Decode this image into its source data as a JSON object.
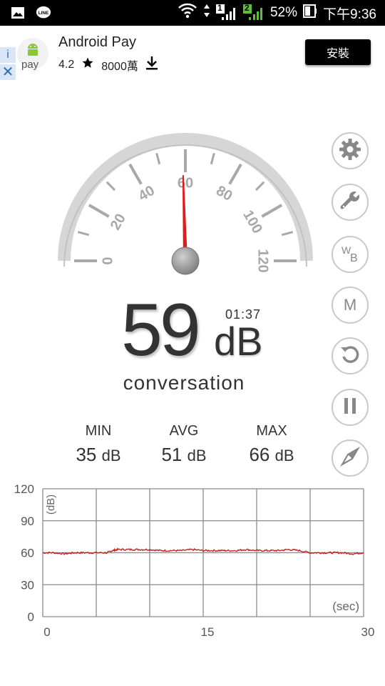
{
  "status_bar": {
    "battery": "52%",
    "time": "下午9:36",
    "sim1": "1",
    "sim2": "2"
  },
  "ad": {
    "app_name": "Android Pay",
    "logo_text": "pay",
    "rating": "4.2",
    "downloads": "8000萬",
    "install_label": "安裝"
  },
  "gauge": {
    "ticks": [
      "0",
      "20",
      "40",
      "60",
      "80",
      "100",
      "120"
    ],
    "min": 0,
    "max": 120,
    "needle_value": 59
  },
  "reading": {
    "value": "59",
    "unit": "dB",
    "timer": "01:37",
    "description": "conversation"
  },
  "stats": {
    "min_label": "MIN",
    "min_value": "35",
    "min_unit": "dB",
    "avg_label": "AVG",
    "avg_value": "51",
    "avg_unit": "dB",
    "max_label": "MAX",
    "max_value": "66",
    "max_unit": "dB"
  },
  "side_buttons": [
    "gear-icon",
    "wrench-icon",
    "wb-icon",
    "m-icon",
    "reset-icon",
    "pause-icon",
    "compass-icon"
  ],
  "side_labels": {
    "wb_w": "W",
    "wb_b": "B",
    "m": "M"
  },
  "colors": {
    "needle": "#e01b1b",
    "graph_line": "#c81e1e",
    "grid": "#8a8a8a"
  },
  "chart_data": {
    "type": "line",
    "ylabel": "(dB)",
    "xlabel": "(sec)",
    "y_ticks": [
      "120",
      "90",
      "60",
      "30",
      "0"
    ],
    "x_ticks": [
      "0",
      "15",
      "30"
    ],
    "ylim": [
      0,
      120
    ],
    "xlim": [
      0,
      30
    ],
    "grid": true,
    "series": [
      {
        "x": [
          0,
          1,
          2,
          3,
          4,
          5,
          6,
          6.5,
          7,
          8,
          9,
          10,
          11,
          12,
          13,
          14,
          15,
          16,
          17,
          18,
          19,
          20,
          21,
          22,
          23,
          24,
          25,
          26,
          27,
          28,
          29,
          30
        ],
        "y": [
          60,
          60,
          59,
          60,
          60,
          60,
          60,
          62,
          63,
          63,
          63,
          63,
          62,
          62,
          62,
          63,
          62,
          62,
          62,
          62,
          63,
          62,
          62,
          62,
          63,
          62,
          60,
          60,
          60,
          60,
          59,
          60
        ]
      }
    ]
  }
}
